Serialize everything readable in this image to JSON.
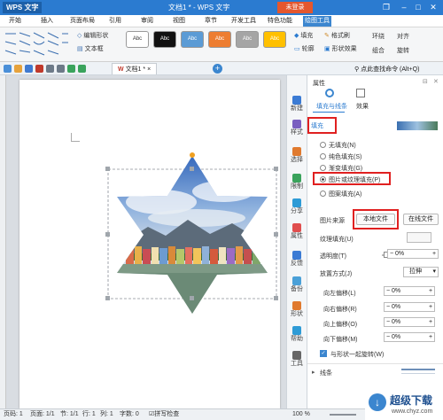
{
  "titlebar": {
    "app": "WPS 文字",
    "doc_title": "文档1 * - WPS 文字",
    "login": "未登录"
  },
  "menu": [
    "开始",
    "插入",
    "页面布局",
    "引用",
    "审阅",
    "视图",
    "章节",
    "开发工具",
    "特色功能",
    "绘图工具"
  ],
  "ribbon": {
    "edit_shape": "编辑形状",
    "textbox": "文本框",
    "fill": "填充",
    "format_brush": "格式刷",
    "outline": "轮廓",
    "shape_effect": "形状效果",
    "wrap": "环绕",
    "align": "对齐",
    "combine": "组合",
    "rotate": "旋转",
    "swatch_label": "Abc",
    "swatches": [
      "#ffffff",
      "#111111",
      "#5b9bd5",
      "#ed7d31",
      "#a5a5a5",
      "#ffc000"
    ]
  },
  "quickaccess": {
    "doc_tab": "文档1 *",
    "search_hint": "点此查找命令 (Alt+Q)"
  },
  "sidebar": [
    {
      "label": "新建",
      "color": "#3b7bd4"
    },
    {
      "label": "样式",
      "color": "#7a5fc0"
    },
    {
      "label": "选择",
      "color": "#e07a2e"
    },
    {
      "label": "限制",
      "color": "#3aa35c"
    },
    {
      "label": "分享",
      "color": "#2e9bd6"
    },
    {
      "label": "属性",
      "color": "#e04e4e"
    },
    {
      "label": "反馈",
      "color": "#3b7bd4"
    },
    {
      "label": "备份",
      "color": "#4aa0d8"
    },
    {
      "label": "形状",
      "color": "#e07a2e"
    },
    {
      "label": "帮助",
      "color": "#2e9bd6"
    },
    {
      "label": "工具",
      "color": "#666666"
    }
  ],
  "panel": {
    "header": "属性",
    "tabs": [
      "填充与线条",
      "效果"
    ],
    "fill_section": "填充",
    "fill_options": [
      "无填充(N)",
      "纯色填充(S)",
      "渐变填充(G)",
      "图片或纹理填充(P)",
      "图案填充(A)"
    ],
    "selected_fill": 3,
    "picture_source_label": "图片来源",
    "local_file": "本地文件",
    "online_file": "在线文件",
    "texture_label": "纹理填充(U)",
    "transparency_label": "透明度(T)",
    "transparency_value": "0%",
    "placement_label": "放置方式(J)",
    "placement_value": "拉伸",
    "offsets": [
      {
        "label": "向左偏移(L)",
        "value": "0%"
      },
      {
        "label": "向右偏移(R)",
        "value": "0%"
      },
      {
        "label": "向上偏移(O)",
        "value": "0%"
      },
      {
        "label": "向下偏移(M)",
        "value": "0%"
      }
    ],
    "rotate_with_shape": "与形状一起旋转(W)",
    "line_section": "线条"
  },
  "status": {
    "page": "页码: 1",
    "pages": "页面: 1/1",
    "section": "节: 1/1",
    "row": "行: 1",
    "col": "列: 1",
    "wordcount": "字数: 0",
    "spell": "拼写检查",
    "zoom": "100 %"
  },
  "watermark": {
    "text": "超级下载",
    "url": "www.chyz.com"
  }
}
